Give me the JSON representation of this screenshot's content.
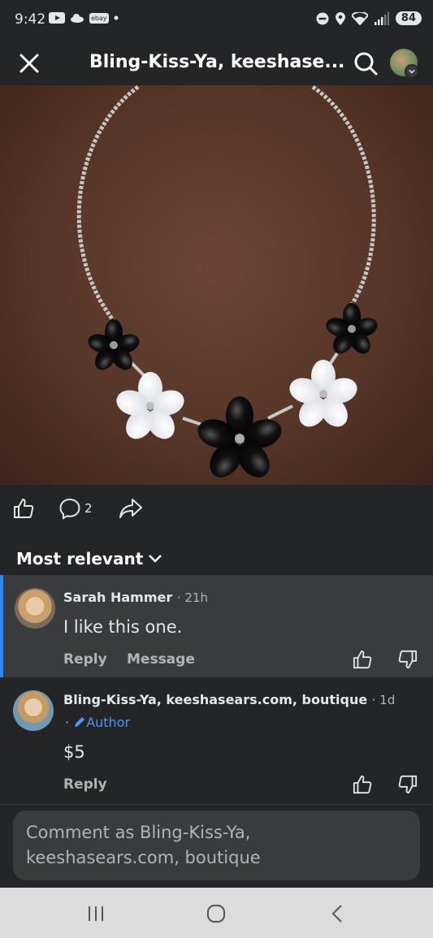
{
  "status_bar": {
    "time": "9:42",
    "battery": "84",
    "left_icons": [
      "youtube-icon",
      "cloud-icon",
      "ebay-icon",
      "dot-icon"
    ],
    "right_icons": [
      "do-not-disturb-icon",
      "location-icon",
      "wifi-icon",
      "signal-icon"
    ],
    "ebay_label": "ebay"
  },
  "header": {
    "title": "Bling-Kiss-Ya, keeshase..."
  },
  "actions": {
    "comment_count": "2"
  },
  "sort": {
    "label": "Most relevant"
  },
  "comments": [
    {
      "name": "Sarah Hammer",
      "time": "· 21h",
      "text": "I like this one.",
      "reply": "Reply",
      "message": "Message"
    },
    {
      "name": "Bling-Kiss-Ya, keeshasears.com, boutique",
      "time": "· 1d",
      "badge": "Author",
      "badge_prefix": "·",
      "text": "$5",
      "reply": "Reply"
    }
  ],
  "composer": {
    "placeholder": "Comment as Bling-Kiss-Ya, keeshasears.com, boutique"
  },
  "colors": {
    "background": "#242526",
    "highlight": "#3a3b3c",
    "accent": "#2d88ff",
    "author": "#4599ff"
  }
}
